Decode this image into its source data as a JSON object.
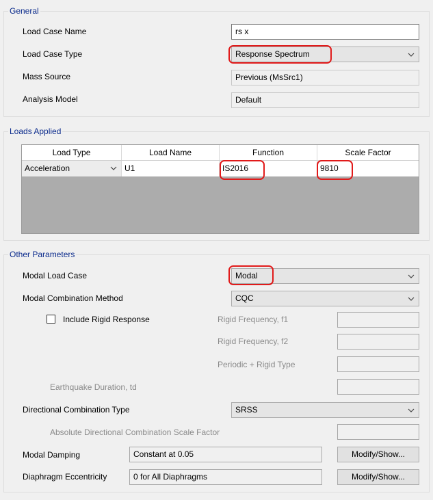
{
  "general": {
    "legend": "General",
    "load_case_name_label": "Load Case Name",
    "load_case_name_value": "rs x",
    "load_case_type_label": "Load Case Type",
    "load_case_type_value": "Response Spectrum",
    "mass_source_label": "Mass Source",
    "mass_source_value": "Previous (MsSrc1)",
    "analysis_model_label": "Analysis Model",
    "analysis_model_value": "Default"
  },
  "loads_applied": {
    "legend": "Loads Applied",
    "columns": [
      "Load Type",
      "Load Name",
      "Function",
      "Scale Factor"
    ],
    "rows": [
      {
        "load_type": "Acceleration",
        "load_name": "U1",
        "function": "IS2016",
        "scale_factor": "9810"
      }
    ]
  },
  "other_parameters": {
    "legend": "Other Parameters",
    "modal_load_case_label": "Modal Load Case",
    "modal_load_case_value": "Modal",
    "modal_combination_method_label": "Modal Combination Method",
    "modal_combination_method_value": "CQC",
    "include_rigid_response_label": "Include Rigid Response",
    "include_rigid_response_checked": false,
    "rigid_frequency_f1_label": "Rigid Frequency, f1",
    "rigid_frequency_f2_label": "Rigid Frequency, f2",
    "periodic_rigid_type_label": "Periodic + Rigid Type",
    "earthquake_duration_label": "Earthquake Duration, td",
    "directional_combination_type_label": "Directional Combination Type",
    "directional_combination_type_value": "SRSS",
    "absolute_directional_label": "Absolute Directional Combination Scale Factor",
    "modal_damping_label": "Modal Damping",
    "modal_damping_value": "Constant at 0.05",
    "diaphragm_eccentricity_label": "Diaphragm Eccentricity",
    "diaphragm_eccentricity_value": "0 for All Diaphragms",
    "modify_show_label": "Modify/Show..."
  },
  "colors": {
    "legend_text": "#0b2b8c",
    "highlight_annotation": "#e11a1a",
    "disabled_text": "#8a8a8a"
  }
}
